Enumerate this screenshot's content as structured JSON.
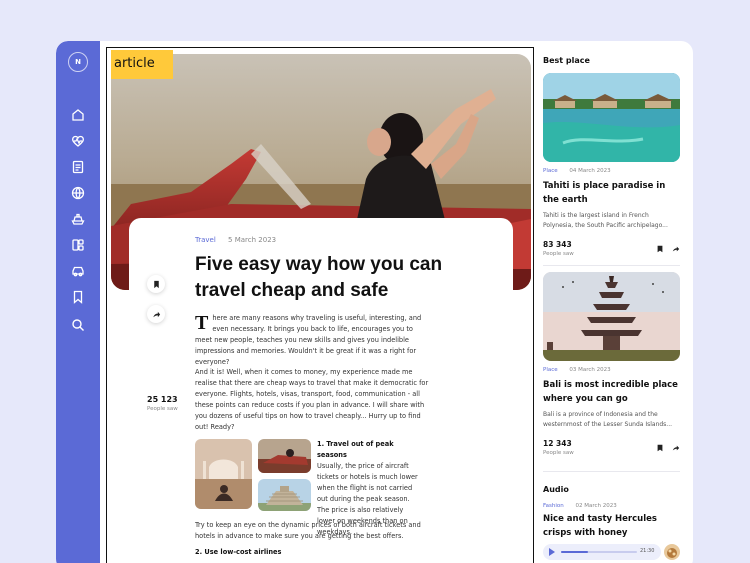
{
  "sidebar": {
    "avatar_letter": "N",
    "items": [
      {
        "icon": "home-icon"
      },
      {
        "icon": "heart-pulse-icon"
      },
      {
        "icon": "document-icon"
      },
      {
        "icon": "globe-icon"
      },
      {
        "icon": "ship-icon"
      },
      {
        "icon": "layout-icon"
      },
      {
        "icon": "car-icon"
      },
      {
        "icon": "bookmark-icon"
      },
      {
        "icon": "search-icon"
      }
    ]
  },
  "annotation": {
    "label": "article"
  },
  "article": {
    "category": "Travel",
    "date": "5 March 2023",
    "title": "Five easy way how you can travel cheap and safe",
    "views": "25 123",
    "views_label": "People saw",
    "dropcap": "T",
    "para1": "here are many reasons why traveling is useful, interesting, and even necessary. It brings you back to life, encourages you to meet new people, teaches you new skills and gives you indelible impressions and memories. Wouldn't it be great if it was a right for everyone?",
    "para2": "And it is! Well, when it comes to money, my experience made me realise that there are cheap ways to travel that make it democratic for everyone. Flights, hotels, visas, transport, food, communication - all these points can reduce costs if you plan in advance. I will share with you dozens of useful tips on how to travel cheaply... Hurry up to find out!  Ready?",
    "section1_title": "1. Travel out of peak seasons",
    "section1_text": "Usually, the price of aircraft tickets or hotels is much lower when the flight is not carried out during the peak season. The price is also relatively lower on weekends than on weekdays.",
    "para3": "Try to keep an eye on the dynamic prices of both aircraft tickets and hotels in advance to make sure you are getting the best offers.",
    "section2_title": "2. Use low-cost airlines"
  },
  "best_place": {
    "heading": "Best place",
    "cards": [
      {
        "category": "Place",
        "date": "04 March 2023",
        "title": "Tahiti is place paradise in the earth",
        "desc": "Tahiti is the largest island in French Polynesia, the South Pacific archipelago...",
        "views": "83 343",
        "views_label": "People saw"
      },
      {
        "category": "Place",
        "date": "03 March 2023",
        "title": "Bali is most incredible place where you can go",
        "desc": "Bali is a province of Indonesia and the westernmost of the Lesser Sunda Islands...",
        "views": "12 343",
        "views_label": "People saw"
      }
    ]
  },
  "audio": {
    "heading": "Audio",
    "category": "Fashion",
    "date": "02 March 2023",
    "title": "Nice and tasty Hercules crisps with honey",
    "time": "21:30",
    "progress": 0.35
  },
  "colors": {
    "accent": "#5b6ad6",
    "annotation": "#ffc93a",
    "background": "#e6e8fa"
  }
}
